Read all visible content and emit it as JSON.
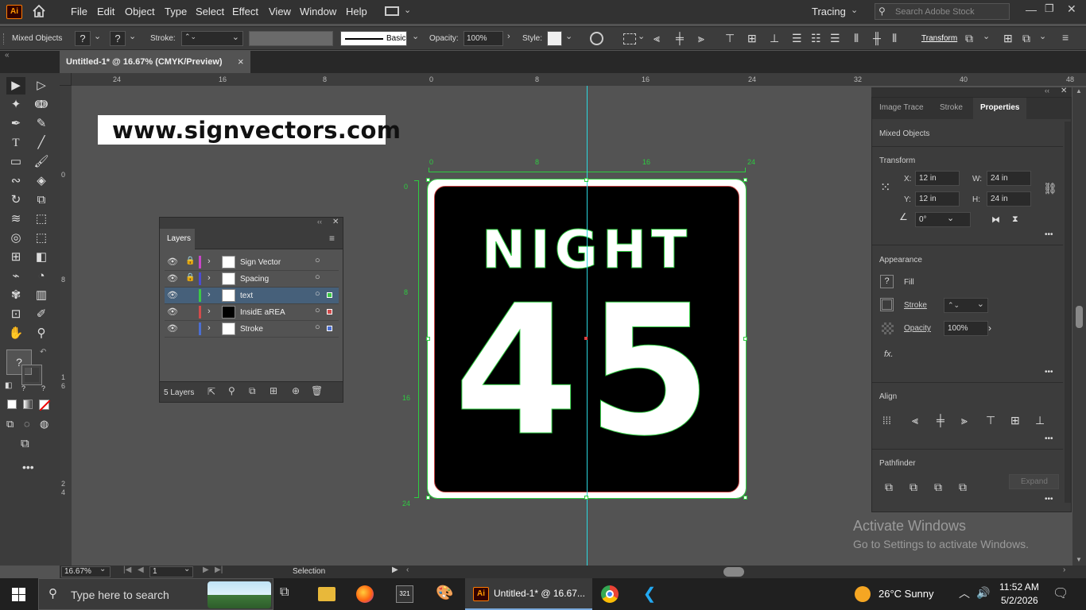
{
  "menubar": {
    "app_icon": "Ai",
    "menus": [
      "File",
      "Edit",
      "Object",
      "Type",
      "Select",
      "Effect",
      "View",
      "Window",
      "Help"
    ],
    "workspace": "Tracing",
    "search_placeholder": "Search Adobe Stock"
  },
  "controlbar": {
    "selection_label": "Mixed Objects",
    "stroke_label": "Stroke:",
    "brush_label": "Basic",
    "opacity_label": "Opacity:",
    "opacity_value": "100%",
    "style_label": "Style:",
    "transform_label": "Transform"
  },
  "tab": {
    "title": "Untitled-1* @ 16.67% (CMYK/Preview)",
    "close": "×"
  },
  "ruler": {
    "top_ticks": [
      "24",
      "16",
      "8",
      "0",
      "8",
      "16",
      "24",
      "32",
      "40",
      "48"
    ],
    "left_ticks": [
      "0",
      "8",
      "1\n6",
      "2\n4"
    ],
    "art_top_ticks": [
      "0",
      "8",
      "16",
      "24"
    ],
    "art_left_ticks": [
      "0",
      "8",
      "16",
      "24"
    ]
  },
  "canvas": {
    "watermark": "www.signvectors.com",
    "sign_line1": "NIGHT",
    "sign_line2": "45"
  },
  "layers": {
    "title": "Layers",
    "items": [
      {
        "name": "Sign Vector",
        "color": "#c846c8",
        "locked": true,
        "thumb": "#ffffff"
      },
      {
        "name": "Spacing",
        "color": "#4b4bd2",
        "locked": true,
        "thumb": "#ffffff"
      },
      {
        "name": "text",
        "color": "#3cc846",
        "locked": false,
        "thumb": "#ffffff"
      },
      {
        "name": "InsidE aREA",
        "color": "#d24b4b",
        "locked": false,
        "thumb": "#000000"
      },
      {
        "name": "Stroke",
        "color": "#4b6ed2",
        "locked": false,
        "thumb": "#ffffff"
      }
    ],
    "count": "5 Layers"
  },
  "properties": {
    "tabs": [
      "Image Trace",
      "Stroke",
      "Properties"
    ],
    "selection": "Mixed Objects",
    "transform_title": "Transform",
    "x_label": "X:",
    "x_value": "12 in",
    "y_label": "Y:",
    "y_value": "12 in",
    "w_label": "W:",
    "w_value": "24 in",
    "h_label": "H:",
    "h_value": "24 in",
    "angle_value": "0°",
    "appearance_title": "Appearance",
    "fill_label": "Fill",
    "stroke_label": "Stroke",
    "opacity_label": "Opacity",
    "opacity_value": "100%",
    "fx_label": "fx.",
    "align_title": "Align",
    "pathfinder_title": "Pathfinder",
    "expand_label": "Expand"
  },
  "status": {
    "zoom": "16.67%",
    "page": "1",
    "mode": "Selection"
  },
  "activate": {
    "title": "Activate Windows",
    "subtitle": "Go to Settings to activate Windows."
  },
  "taskbar": {
    "search_placeholder": "Type here to search",
    "active_app": "Untitled-1* @ 16.67...",
    "weather": "26°C  Sunny",
    "time": "11:52 AM",
    "date": "5/2/2026"
  }
}
